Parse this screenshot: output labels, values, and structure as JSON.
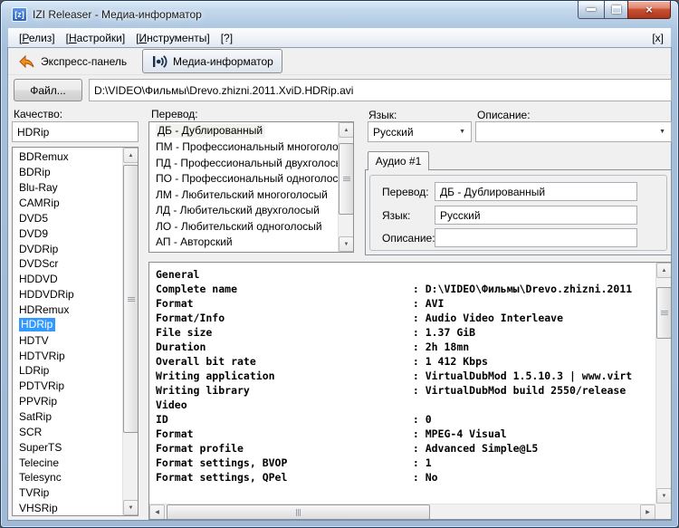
{
  "window": {
    "title": "IZI Releaser - Медиа-информатор",
    "icon_text": "[z]"
  },
  "menu": {
    "items": [
      {
        "pre": "[",
        "key": "Р",
        "post": "елиз]"
      },
      {
        "pre": "[",
        "key": "Н",
        "post": "астройки]"
      },
      {
        "pre": "[",
        "key": "И",
        "post": "нструменты]"
      },
      {
        "pre": "[?]",
        "key": "",
        "post": ""
      }
    ],
    "right_close": "[x]"
  },
  "toolbar": {
    "express": "Экспресс-панель",
    "media_informer": "Медиа-информатор"
  },
  "file": {
    "button_label": "Файл...",
    "path": "D:\\VIDEO\\Фильмы\\Drevo.zhizni.2011.XviD.HDRip.avi"
  },
  "quality": {
    "label": "Качество:",
    "filter_value": "HDRip",
    "selected": "HDRip",
    "items": [
      "BDRemux",
      "BDRip",
      "Blu-Ray",
      "CAMRip",
      "DVD5",
      "DVD9",
      "DVDRip",
      "DVDScr",
      "HDDVD",
      "HDDVDRip",
      "HDRemux",
      "HDRip",
      "HDTV",
      "HDTVRip",
      "LDRip",
      "PDTVRip",
      "PPVRip",
      "SatRip",
      "SCR",
      "SuperTS",
      "Telecine",
      "Telesync",
      "TVRip",
      "VHSRip"
    ]
  },
  "translation": {
    "label": "Перевод:",
    "selected": "ДБ - Дублированный",
    "items": [
      "ДБ - Дублированный",
      "ПМ - Профессиональный многоголосый",
      "ПД - Профессиональный двухголосый",
      "ПО - Профессиональный одноголосый",
      "ЛМ - Любительский многоголосый",
      "ЛД - Любительский двухголосый",
      "ЛО - Любительский одноголосый",
      "АП - Авторский"
    ]
  },
  "language": {
    "label": "Язык:",
    "value": "Русский"
  },
  "description": {
    "label": "Описание:",
    "value": ""
  },
  "audio_tab": {
    "title": "Аудио #1",
    "fields": [
      {
        "label": "Перевод:",
        "value": "ДБ - Дублированный"
      },
      {
        "label": "Язык:",
        "value": "Русский"
      },
      {
        "label": "Описание:",
        "value": ""
      }
    ]
  },
  "mediainfo": {
    "lines": [
      "General",
      "Complete name                            : D:\\VIDEO\\Фильмы\\Drevo.zhizni.2011",
      "Format                                   : AVI",
      "Format/Info                              : Audio Video Interleave",
      "File size                                : 1.37 GiB",
      "Duration                                 : 2h 18mn",
      "Overall bit rate                         : 1 412 Kbps",
      "Writing application                      : VirtualDubMod 1.5.10.3 | www.virt",
      "Writing library                          : VirtualDubMod build 2550/release",
      "",
      "Video",
      "ID                                       : 0",
      "Format                                   : MPEG-4 Visual",
      "Format profile                           : Advanced Simple@L5",
      "Format settings, BVOP                    : 1",
      "Format settings, QPel                    : No"
    ]
  },
  "colors": {
    "selection": "#3399FF",
    "close_button": "#c24a30",
    "titlebar_glass": "#b3cbe3",
    "client_bg": "#f0f0f0"
  }
}
